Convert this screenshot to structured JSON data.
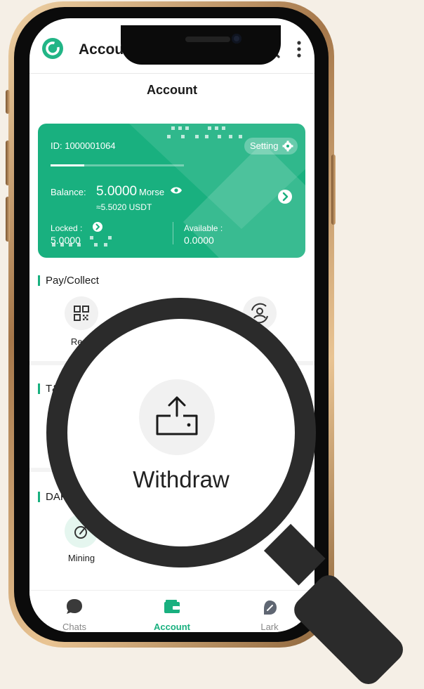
{
  "header": {
    "title": "Account"
  },
  "page": {
    "title": "Account"
  },
  "card": {
    "id_text": "ID:  1000001064",
    "setting_label": "Setting",
    "balance_label": "Balance:",
    "balance_value": "5.0000",
    "balance_unit": "Morse",
    "balance_usdt": "≈5.5020 USDT",
    "locked_label": "Locked :",
    "locked_value": "5.0000",
    "available_label": "Available :",
    "available_value": "0.0000",
    "progress_fraction": 0.25
  },
  "sections": {
    "pay_collect": {
      "title": "Pay/Collect",
      "receive_partial": "Rece"
    },
    "t_partial": "T&",
    "dapp_partial": "DAP",
    "mining_label": "Mining"
  },
  "magnifier": {
    "label": "Withdraw"
  },
  "bottom_nav": {
    "items": [
      {
        "label": "Chats"
      },
      {
        "label": "Account"
      },
      {
        "label": "Lark"
      }
    ],
    "active_index": 1
  },
  "colors": {
    "accent": "#19b07f",
    "background": "#f5efe6"
  }
}
